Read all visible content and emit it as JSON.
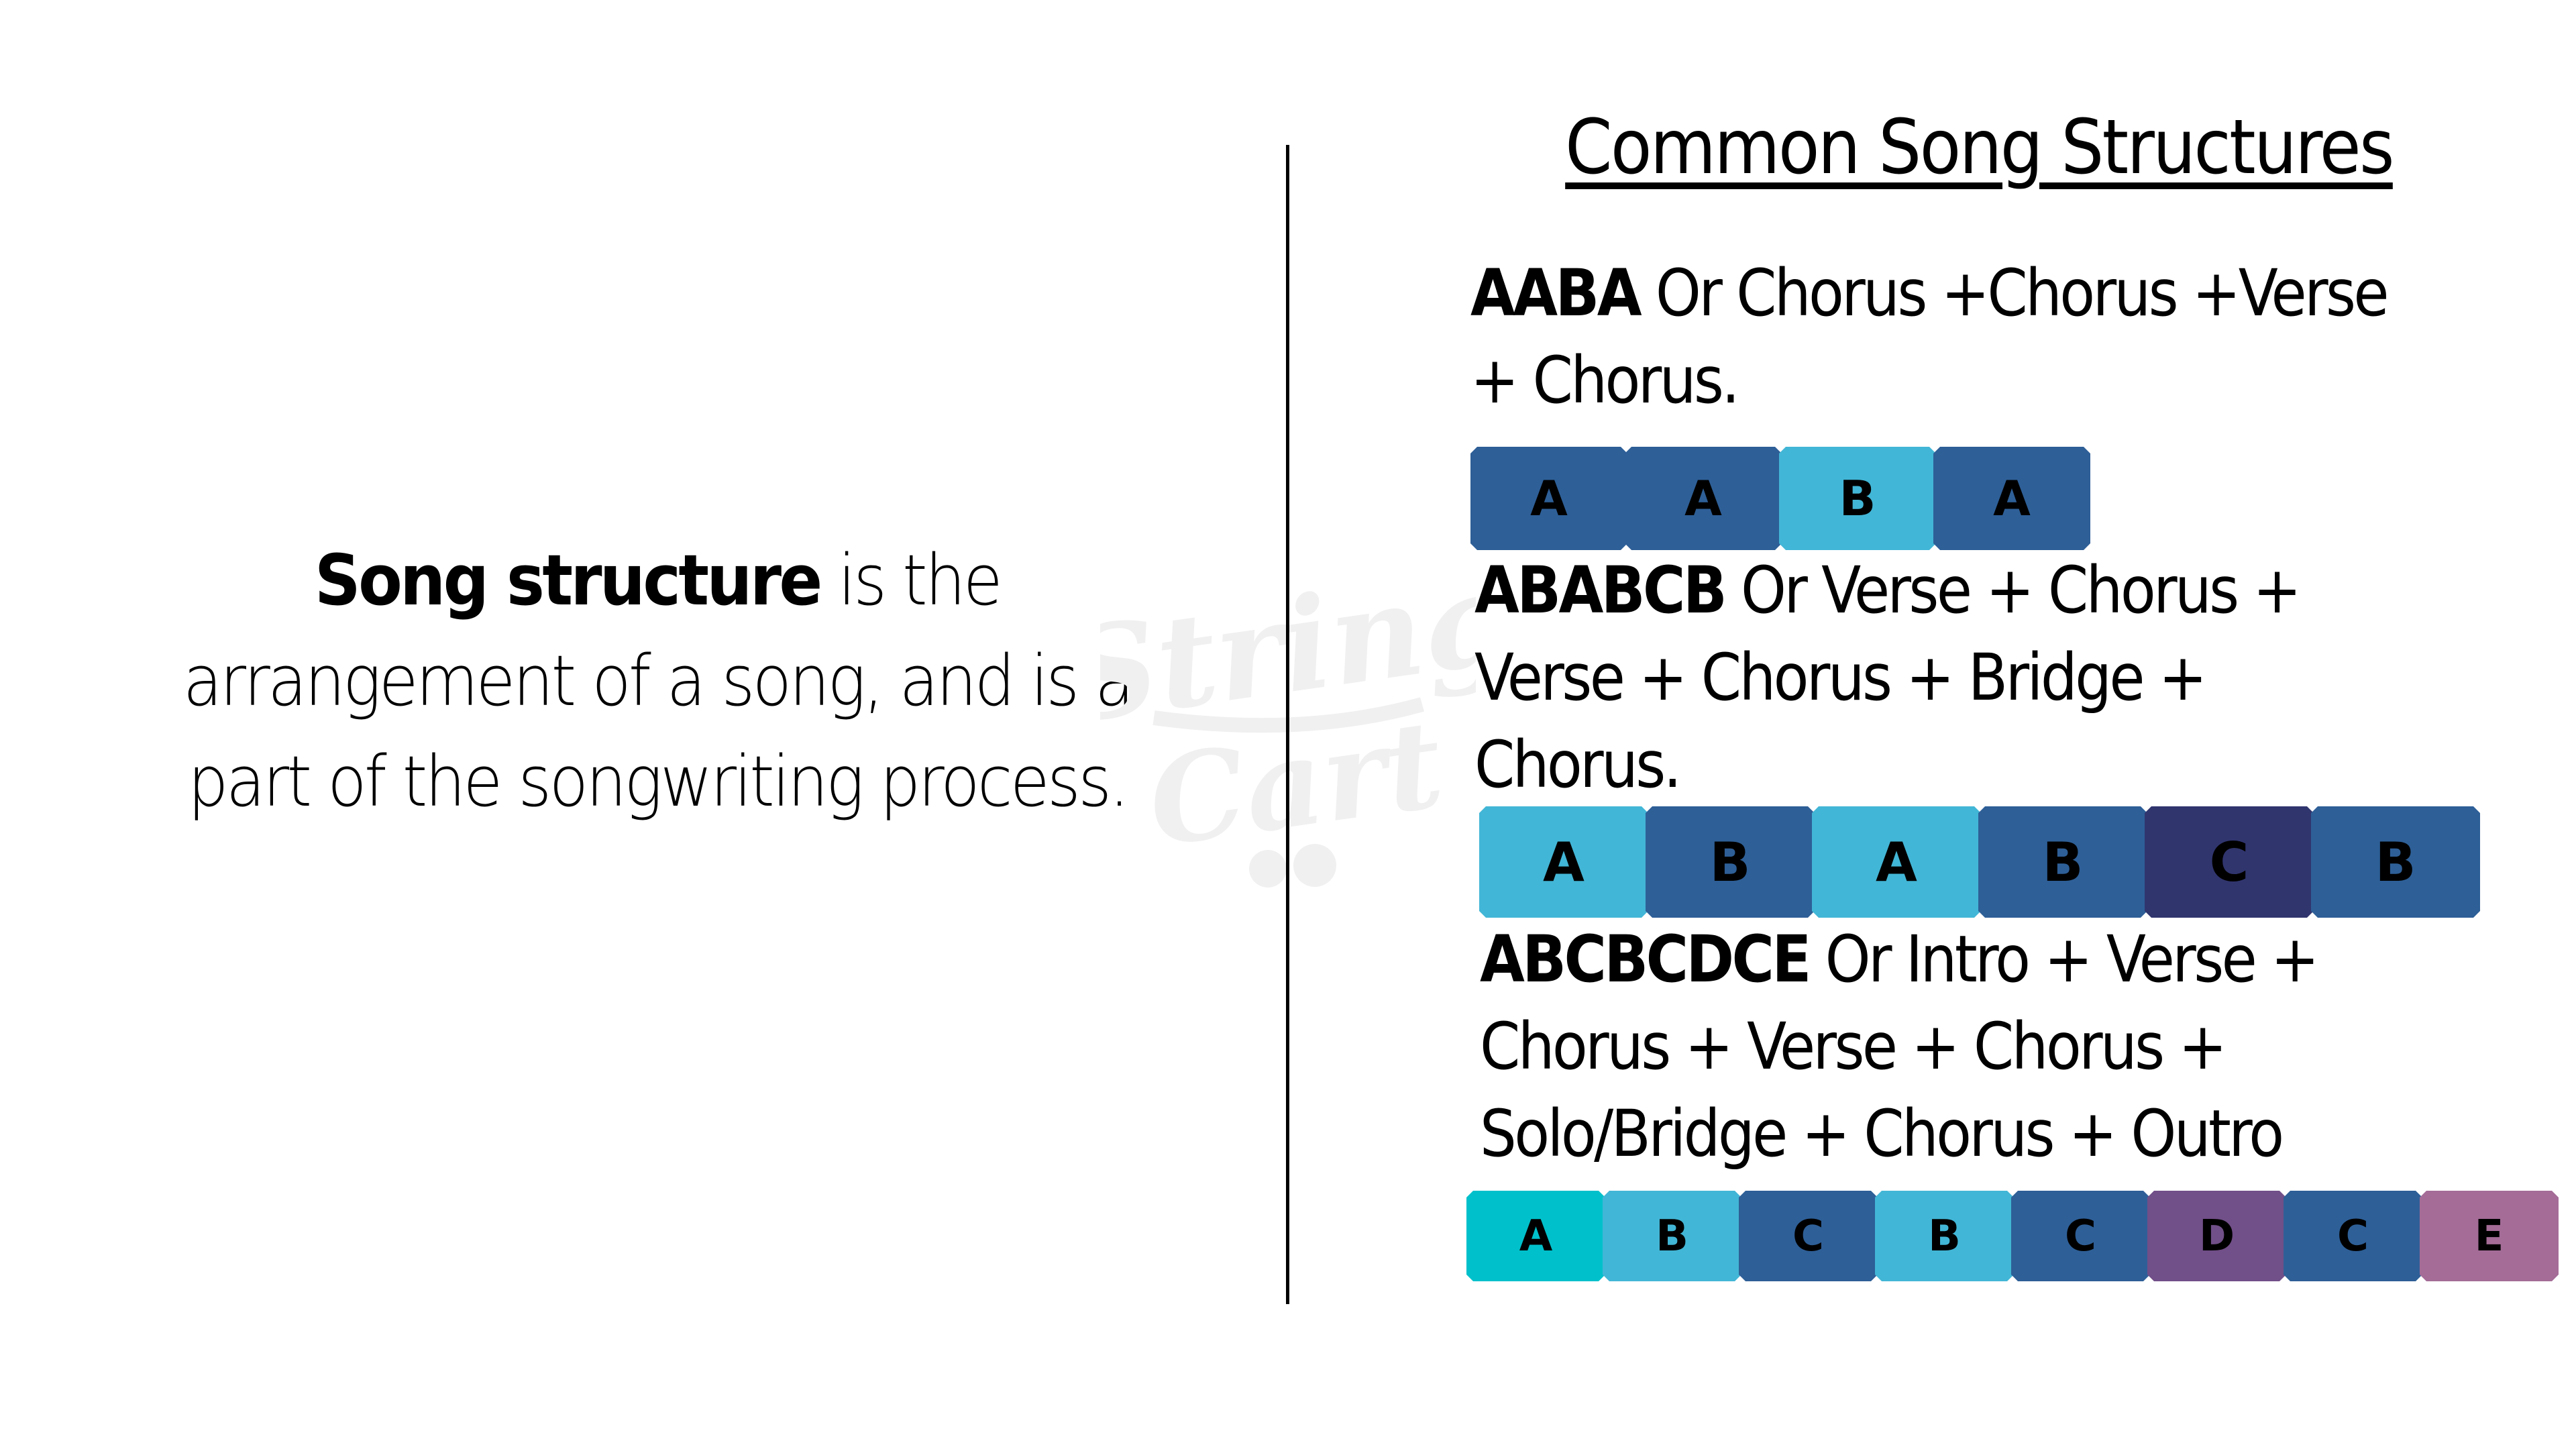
{
  "definition": {
    "term": "Song structure",
    "text": " is the arrangement of a song, and is a part of the songwriting process."
  },
  "watermark": {
    "line1": "String",
    "line2": "Cart",
    "icon": "shopping-cart-icon"
  },
  "title": "Common Song Structures",
  "colors": {
    "navy_blue": "#2E5F97",
    "sky_blue": "#42B6D6",
    "dark_indigo": "#30356E",
    "teal": "#00C1CB",
    "purple": "#714F88",
    "mauve": "#A46C97",
    "watermark_gray": "#F0F0F0"
  },
  "structures": [
    {
      "code": "AABA",
      "description": " Or Chorus +Chorus +Verse + Chorus.",
      "segments": [
        {
          "label": "A",
          "color": "#2E5F97"
        },
        {
          "label": "A",
          "color": "#2E5F97"
        },
        {
          "label": "B",
          "color": "#42B6D6"
        },
        {
          "label": "A",
          "color": "#2E5F97"
        }
      ]
    },
    {
      "code": "ABABCB",
      "description": " Or Verse + Chorus + Verse + Chorus + Bridge + Chorus.",
      "segments": [
        {
          "label": "A",
          "color": "#42B6D6"
        },
        {
          "label": "B",
          "color": "#2E5F97"
        },
        {
          "label": "A",
          "color": "#42B6D6"
        },
        {
          "label": "B",
          "color": "#2E5F97"
        },
        {
          "label": "C",
          "color": "#30356E"
        },
        {
          "label": "B",
          "color": "#2E5F97"
        }
      ]
    },
    {
      "code": "ABCBCDCE",
      "description": " Or Intro + Verse + Chorus + Verse + Chorus + Solo/Bridge + Chorus + Outro",
      "segments": [
        {
          "label": "A",
          "color": "#00C1CB"
        },
        {
          "label": "B",
          "color": "#42B6D6"
        },
        {
          "label": "C",
          "color": "#2E5F97"
        },
        {
          "label": "B",
          "color": "#42B6D6"
        },
        {
          "label": "C",
          "color": "#2E5F97"
        },
        {
          "label": "D",
          "color": "#714F88"
        },
        {
          "label": "C",
          "color": "#2E5F97"
        },
        {
          "label": "E",
          "color": "#A46C97"
        }
      ]
    }
  ]
}
